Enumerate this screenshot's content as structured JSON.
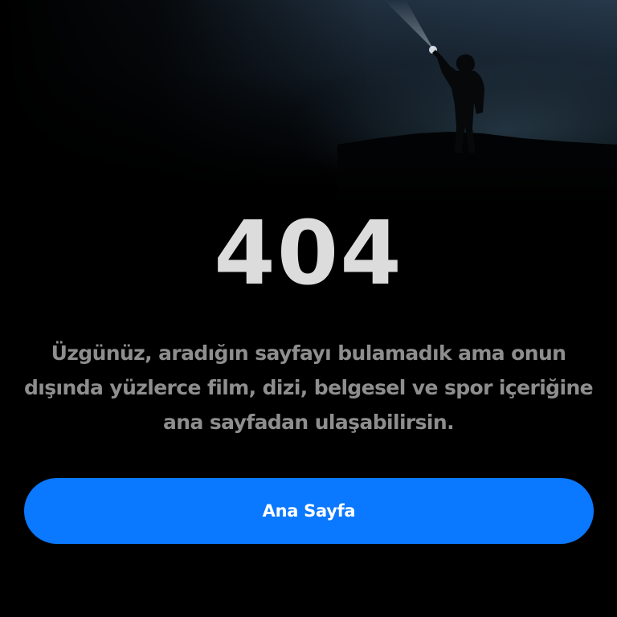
{
  "error": {
    "code": "404",
    "message": "Üzgünüz, aradığın sayfayı bulamadık ama onun dışında yüzlerce film, dizi, belgesel ve spor içeriğine ana sayfadan ulaşabilirsin."
  },
  "actions": {
    "home_label": "Ana Sayfa"
  },
  "hero": {
    "image": "person-with-flashlight-at-night"
  },
  "colors": {
    "background": "#000000",
    "code_text": "#dcdcdc",
    "message_text": "#8e8e8e",
    "button_bg": "#0a78ff",
    "button_text": "#ffffff"
  }
}
